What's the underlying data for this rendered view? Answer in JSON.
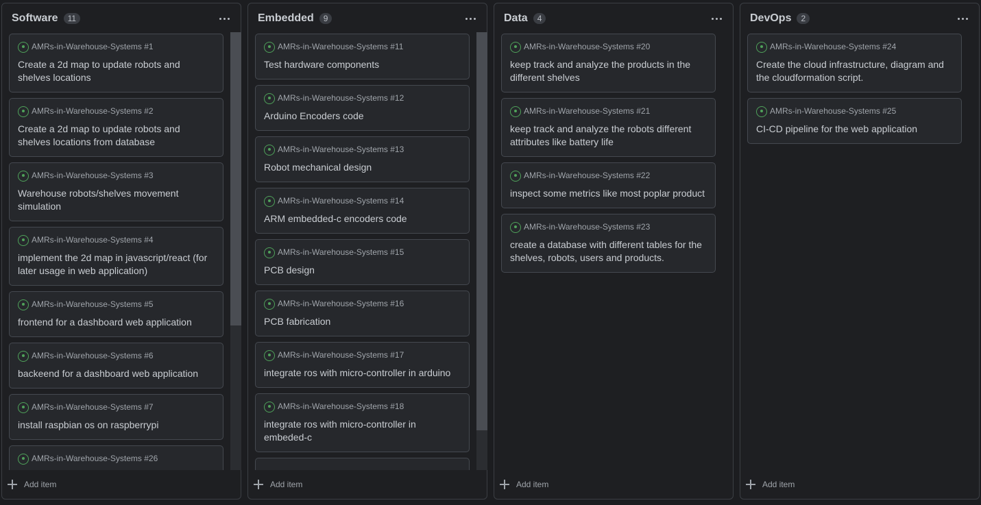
{
  "columns": [
    {
      "title": "Software",
      "count": "11",
      "add_label": "Add item",
      "scrollbar": {
        "visible": true,
        "thumb_fraction": 0.67
      },
      "cards": [
        {
          "repo": "AMRs-in-Warehouse-Systems #1",
          "title": "Create a 2d map to update robots and shelves locations"
        },
        {
          "repo": "AMRs-in-Warehouse-Systems #2",
          "title": "Create a 2d map to update robots and shelves locations from database"
        },
        {
          "repo": "AMRs-in-Warehouse-Systems #3",
          "title": "Warehouse robots/shelves movement simulation"
        },
        {
          "repo": "AMRs-in-Warehouse-Systems #4",
          "title": "implement the 2d map in javascript/react (for later usage in web application)"
        },
        {
          "repo": "AMRs-in-Warehouse-Systems #5",
          "title": "frontend for a dashboard web application"
        },
        {
          "repo": "AMRs-in-Warehouse-Systems #6",
          "title": "backeend for a dashboard web application"
        },
        {
          "repo": "AMRs-in-Warehouse-Systems #7",
          "title": "install raspbian os on raspberrypi"
        },
        {
          "repo": "AMRs-in-Warehouse-Systems #26",
          "title": ""
        }
      ]
    },
    {
      "title": "Embedded",
      "count": "9",
      "add_label": "Add item",
      "scrollbar": {
        "visible": true,
        "thumb_fraction": 0.91
      },
      "cards": [
        {
          "repo": "AMRs-in-Warehouse-Systems #11",
          "title": "Test hardware components"
        },
        {
          "repo": "AMRs-in-Warehouse-Systems #12",
          "title": "Arduino Encoders code"
        },
        {
          "repo": "AMRs-in-Warehouse-Systems #13",
          "title": "Robot mechanical design"
        },
        {
          "repo": "AMRs-in-Warehouse-Systems #14",
          "title": "ARM embedded-c encoders code"
        },
        {
          "repo": "AMRs-in-Warehouse-Systems #15",
          "title": "PCB design"
        },
        {
          "repo": "AMRs-in-Warehouse-Systems #16",
          "title": "PCB fabrication"
        },
        {
          "repo": "AMRs-in-Warehouse-Systems #17",
          "title": "integrate ros with micro-controller in arduino"
        },
        {
          "repo": "AMRs-in-Warehouse-Systems #18",
          "title": "integrate ros with micro-controller in embeded-c"
        },
        {
          "repo": "",
          "title": ""
        }
      ]
    },
    {
      "title": "Data",
      "count": "4",
      "add_label": "Add item",
      "scrollbar": {
        "visible": false,
        "thumb_fraction": 0
      },
      "cards": [
        {
          "repo": "AMRs-in-Warehouse-Systems #20",
          "title": "keep track and analyze the products in the different shelves"
        },
        {
          "repo": "AMRs-in-Warehouse-Systems #21",
          "title": "keep track and analyze the robots different attributes like battery life"
        },
        {
          "repo": "AMRs-in-Warehouse-Systems #22",
          "title": "inspect some metrics like most poplar product"
        },
        {
          "repo": "AMRs-in-Warehouse-Systems #23",
          "title": "create a database with different tables for the shelves, robots, users and products."
        }
      ]
    },
    {
      "title": "DevOps",
      "count": "2",
      "add_label": "Add item",
      "scrollbar": {
        "visible": false,
        "thumb_fraction": 0
      },
      "cards": [
        {
          "repo": "AMRs-in-Warehouse-Systems #24",
          "title": "Create the cloud infrastructure, diagram and the cloudformation script."
        },
        {
          "repo": "AMRs-in-Warehouse-Systems #25",
          "title": "CI-CD pipeline for the web application"
        }
      ]
    }
  ],
  "icons": {
    "issue": "open-issue-icon",
    "menu": "more-horizontal-icon",
    "add": "plus-icon"
  },
  "colors": {
    "background": "#1c1d20",
    "card": "#26282c",
    "open_issue": "#4fa25a",
    "text": "#c9cdd2"
  }
}
